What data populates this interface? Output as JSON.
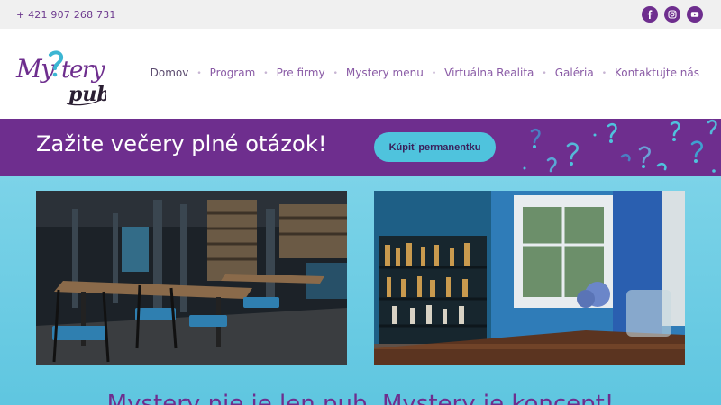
{
  "topbar": {
    "phone": "+ 421 907 268 731",
    "socials": [
      {
        "name": "facebook-icon"
      },
      {
        "name": "instagram-icon"
      },
      {
        "name": "youtube-icon"
      }
    ]
  },
  "header": {
    "logo": {
      "line1": "Mystery",
      "line2": "pub"
    },
    "nav": [
      {
        "label": "Domov"
      },
      {
        "label": "Program"
      },
      {
        "label": "Pre firmy"
      },
      {
        "label": "Mystery menu"
      },
      {
        "label": "Virtuálna Realita"
      },
      {
        "label": "Galéria"
      },
      {
        "label": "Kontaktujte nás"
      }
    ]
  },
  "banner": {
    "headline": "Zažite večery plné otázok!",
    "cta_label": "Kúpiť permanentku"
  },
  "main": {
    "tagline": "Mystery nie je len pub. Mystery je koncept!"
  },
  "colors": {
    "brand_purple": "#6e2e8e",
    "accent_cyan": "#4fc3dd",
    "background_cyan": "#6ccde6"
  }
}
